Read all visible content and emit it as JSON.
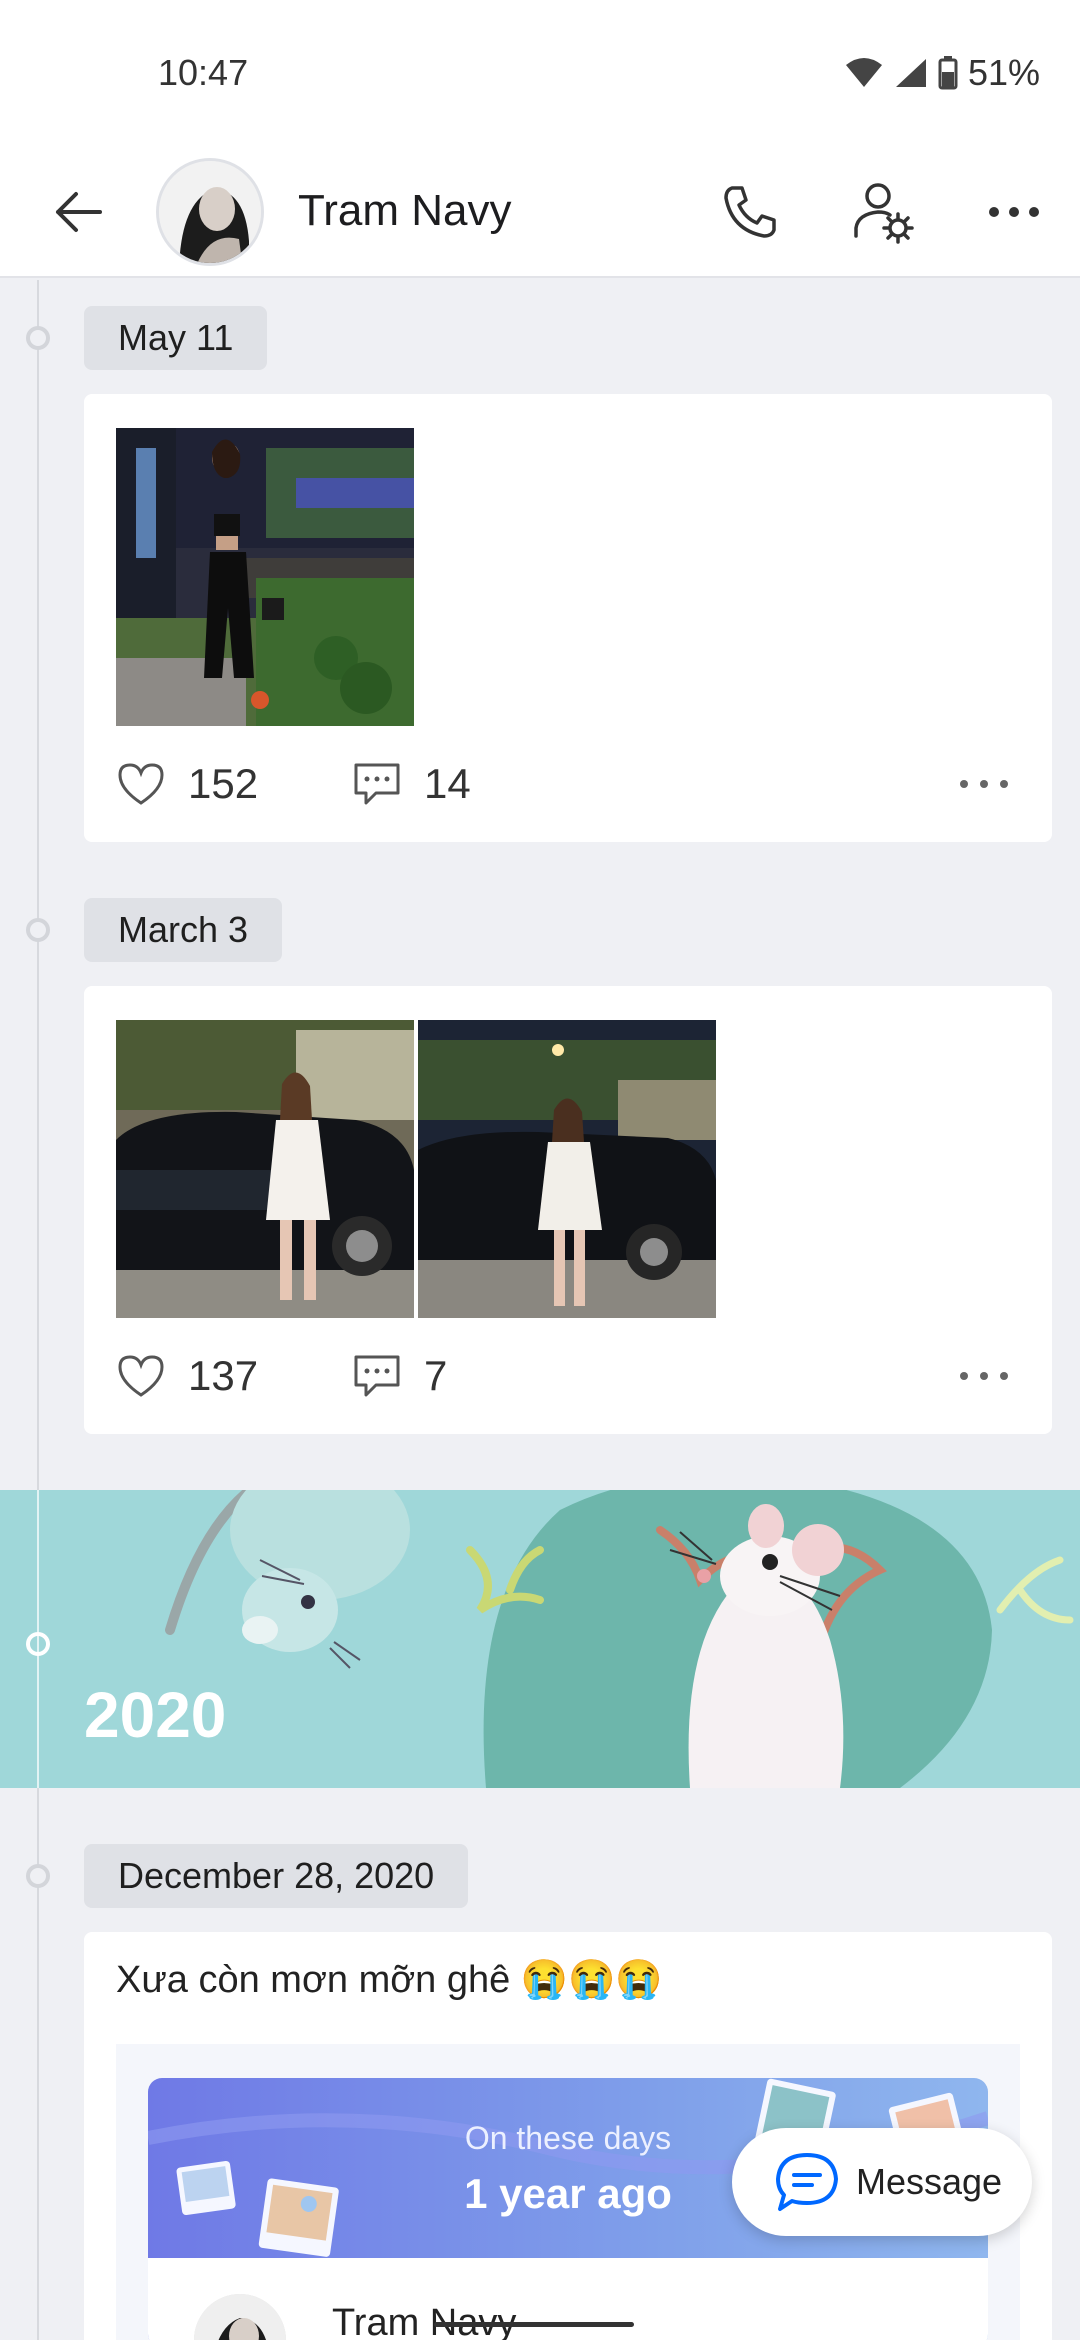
{
  "status_bar": {
    "time": "10:47",
    "battery": "51%"
  },
  "header": {
    "contact_name": "Tram Navy"
  },
  "timeline": [
    {
      "date": "May 11",
      "likes": "152",
      "comments": "14",
      "photo_count": 1
    },
    {
      "date": "March 3",
      "likes": "137",
      "comments": "7",
      "photo_count": 2
    }
  ],
  "year_banner": {
    "year": "2020"
  },
  "post": {
    "date": "December 28, 2020",
    "text": "Xưa còn mơn mỡn ghê 😭😭😭",
    "memory": {
      "line1": "On these days",
      "line2": "1 year ago",
      "author": "Tram Navy"
    }
  },
  "fab": {
    "label": "Message"
  },
  "colors": {
    "accent": "#0068ff",
    "banner": "#9fd7d9",
    "memory_gradient": "#6f79e6"
  }
}
